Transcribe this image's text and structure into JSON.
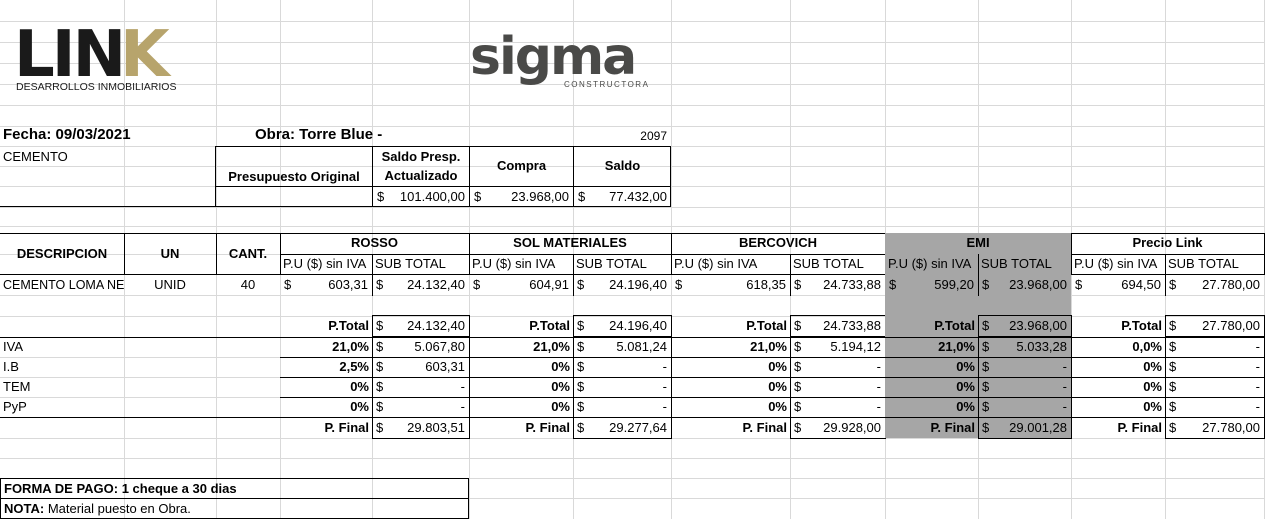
{
  "logos": {
    "link_text": "LIN",
    "link_k": "K",
    "link_sub": "DESARROLLOS INMOBILIARIOS",
    "sigma_text": "sigma",
    "sigma_sub": "CONSTRUCTORA",
    "link_color": "#1a1a1a",
    "link_k_color": "#b7a46c",
    "sigma_color": "#4a4a48",
    "sigma_accent": "#8a8a88"
  },
  "header": {
    "fecha": "Fecha: 09/03/2021",
    "obra": "Obra: Torre Blue -",
    "numero": "2097"
  },
  "budget": {
    "material": "CEMENTO",
    "col_original": "Presupuesto Original",
    "col_saldo_presp_1": "Saldo Presp.",
    "col_saldo_presp_2": "Actualizado",
    "col_compra": "Compra",
    "col_saldo": "Saldo",
    "saldo_presp": "101.400,00",
    "compra": "23.968,00",
    "saldo": "77.432,00",
    "currency": "$"
  },
  "table": {
    "col_descripcion": "DESCRIPCION",
    "col_un": "UN",
    "col_cant": "CANT.",
    "pu_label": "P.U ($) sin IVA",
    "sub_label": "SUB TOTAL",
    "item": {
      "descripcion": "CEMENTO LOMA NEGRA",
      "un": "UNID",
      "cant": "40"
    },
    "row_labels": [
      "IVA",
      "I.B",
      "TEM",
      "PyP"
    ],
    "ptotal_label": "P.Total",
    "pfinal_label": "P. Final",
    "suppliers": [
      {
        "name": "ROSSO",
        "pu": "603,31",
        "sub": "24.132,40",
        "ptotal": "24.132,40",
        "pct": [
          "21,0%",
          "2,5%",
          "0%",
          "0%"
        ],
        "amt": [
          "5.067,80",
          "603,31",
          "-",
          "-"
        ],
        "pfinal": "29.803,51"
      },
      {
        "name": "SOL MATERIALES",
        "pu": "604,91",
        "sub": "24.196,40",
        "ptotal": "24.196,40",
        "pct": [
          "21,0%",
          "0%",
          "0%",
          "0%"
        ],
        "amt": [
          "5.081,24",
          "-",
          "-",
          "-"
        ],
        "pfinal": "29.277,64"
      },
      {
        "name": "BERCOVICH",
        "pu": "618,35",
        "sub": "24.733,88",
        "ptotal": "24.733,88",
        "pct": [
          "21,0%",
          "0%",
          "0%",
          "0%"
        ],
        "amt": [
          "5.194,12",
          "-",
          "-",
          "-"
        ],
        "pfinal": "29.928,00"
      },
      {
        "name": "EMI",
        "pu": "599,20",
        "sub": "23.968,00",
        "ptotal": "23.968,00",
        "pct": [
          "21,0%",
          "0%",
          "0%",
          "0%"
        ],
        "amt": [
          "5.033,28",
          "-",
          "-",
          "-"
        ],
        "pfinal": "29.001,28"
      },
      {
        "name": "Precio Link",
        "pu": "694,50",
        "sub": "27.780,00",
        "ptotal": "27.780,00",
        "pct": [
          "0,0%",
          "0%",
          "0%",
          "0%"
        ],
        "amt": [
          "-",
          "-",
          "-",
          "-"
        ],
        "pfinal": "27.780,00"
      }
    ],
    "highlight_color": "#a6a6a6"
  },
  "footer": {
    "forma_pago": "FORMA DE PAGO: 1 cheque a 30 dias",
    "nota_label": "NOTA:",
    "nota_text": " Material puesto en Obra."
  }
}
